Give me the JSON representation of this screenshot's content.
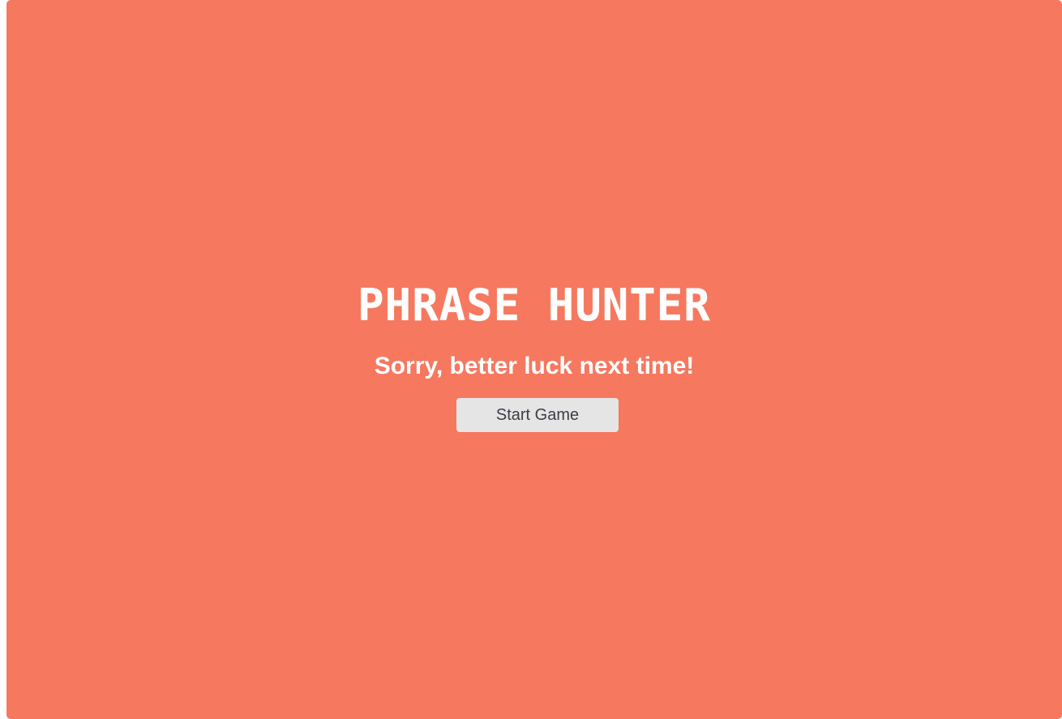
{
  "colors": {
    "overlay_background": "#F5785F",
    "title_text": "#FFFFFF",
    "message_text": "#FFFFFF",
    "button_background": "#E5E5E5",
    "button_text": "#3A3F45"
  },
  "overlay": {
    "title": "PHRASE HUNTER",
    "message": "Sorry, better luck next time!",
    "start_button_label": "Start Game"
  }
}
